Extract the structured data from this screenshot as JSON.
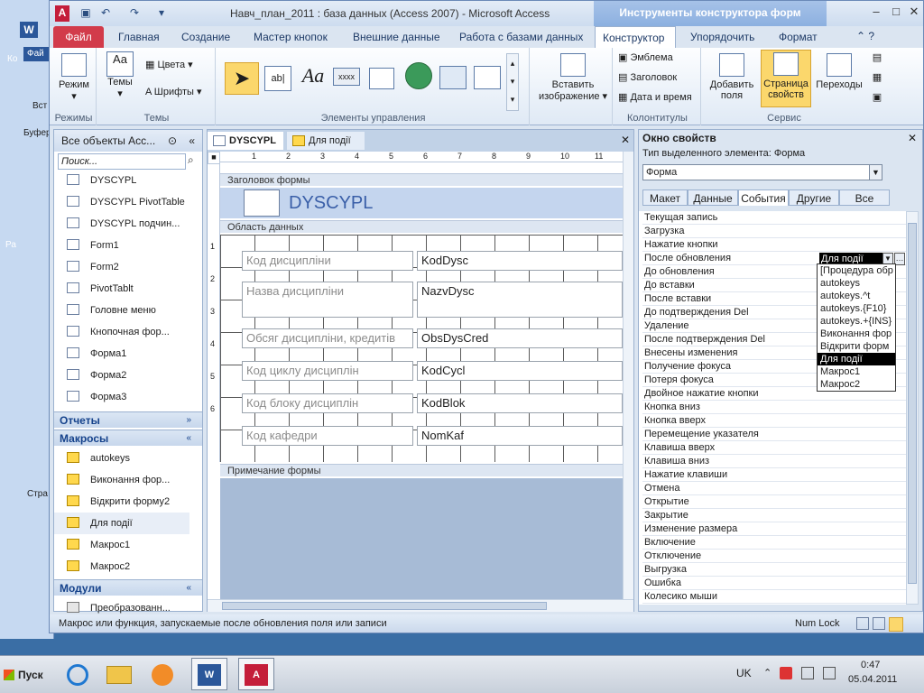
{
  "bg_window": {
    "logo": "W",
    "tab": "Фай",
    "text1": "Вст",
    "text2": "Буфер",
    "text3": "Стра",
    "side1": "Ко",
    "side2": "Ра"
  },
  "window": {
    "title": "Навч_план_2011 : база данных (Access 2007) - Microsoft Access",
    "context_tab": "Инструменты конструктора форм"
  },
  "tabs": {
    "file": "Файл",
    "home": "Главная",
    "create": "Создание",
    "wizard": "Мастер кнопок",
    "external": "Внешние данные",
    "db": "Работа с базами данных",
    "designer": "Конструктор",
    "arrange": "Упорядочить",
    "format": "Формат"
  },
  "ribbon": {
    "modes": {
      "view": "Режим",
      "label": "Режимы"
    },
    "themes": {
      "themes": "Темы",
      "colors": "Цвета",
      "fonts": "Шрифты",
      "label": "Темы"
    },
    "controls": {
      "label": "Элементы управления",
      "textbox": "ab|",
      "label_ctl": "Aa",
      "button": "xxxx"
    },
    "insert": {
      "insert_image": "Вставить",
      "insert_image2": "изображение"
    },
    "header": {
      "logo": "Эмблема",
      "title": "Заголовок",
      "datetime": "Дата и время",
      "label": "Колонтитулы"
    },
    "tools": {
      "add_fields": "Добавить",
      "add_fields2": "поля",
      "props_page": "Страница",
      "props_page2": "свойств",
      "transitions": "Переходы",
      "label": "Сервис"
    }
  },
  "nav": {
    "header": "Все объекты Acc...",
    "search_placeholder": "Поиск...",
    "forms": [
      "DYSCYPL",
      "DYSCYPL PivotTable",
      "DYSCYPL подчин...",
      "Form1",
      "Form2",
      "PivotTablt",
      "Головне меню",
      "Кнопочная фор...",
      "Форма1",
      "Форма2",
      "Форма3"
    ],
    "reports_section": "Отчеты",
    "macros_section": "Макросы",
    "macros": [
      "autokeys",
      "Виконання фор...",
      "Відкрити форму2",
      "Для події",
      "Макрос1",
      "Макрос2"
    ],
    "modules_section": "Модули",
    "modules": [
      "Преобразованн..."
    ]
  },
  "doc": {
    "tab1": "DYSCYPL",
    "tab2": "Для події",
    "header_band": "Заголовок формы",
    "detail_band": "Область данных",
    "footer_band": "Примечание формы",
    "form_title": "DYSCYPL",
    "fields": [
      {
        "label": "Код дисципліни",
        "field": "KodDysc"
      },
      {
        "label": "Назва дисципліни",
        "field": "NazvDysc"
      },
      {
        "label": "Обсяг дисципліни, кредитів",
        "field": "ObsDysCred"
      },
      {
        "label": "Код циклу дисциплін",
        "field": "KodCycl"
      },
      {
        "label": "Код блоку дисциплін",
        "field": "KodBlok"
      },
      {
        "label": "Код кафедри",
        "field": "NomKaf"
      }
    ],
    "ruler_nums": [
      "1",
      "2",
      "3",
      "4",
      "5",
      "6",
      "7",
      "8",
      "9",
      "10",
      "11"
    ],
    "vruler_nums": [
      "1",
      "2",
      "3",
      "4",
      "5",
      "6"
    ]
  },
  "props": {
    "title": "Окно свойств",
    "type_label": "Тип выделенного элемента:  Форма",
    "selector": "Форма",
    "tabs": [
      "Макет",
      "Данные",
      "События",
      "Другие",
      "Все"
    ],
    "rows": [
      "Текущая запись",
      "Загрузка",
      "Нажатие кнопки",
      "После обновления",
      "До обновления",
      "До вставки",
      "После вставки",
      "До подтверждения Del",
      "Удаление",
      "После подтверждения Del",
      "Внесены изменения",
      "Получение фокуса",
      "Потеря фокуса",
      "Двойное нажатие кнопки",
      "Кнопка вниз",
      "Кнопка вверх",
      "Перемещение указателя",
      "Клавиша вверх",
      "Клавиша вниз",
      "Нажатие клавиши",
      "Отмена",
      "Открытие",
      "Закрытие",
      "Изменение размера",
      "Включение",
      "Отключение",
      "Выгрузка",
      "Ошибка",
      "Колесико мыши"
    ],
    "active_value": "Для події",
    "dropdown": [
      "[Процедура обр",
      "autokeys",
      "autokeys.^t",
      "autokeys.{F10}",
      "autokeys.+{INS}",
      "Виконання фор",
      "Відкрити форм",
      "Для події",
      "Макрос1",
      "Макрос2"
    ]
  },
  "status": {
    "text": "Макрос или функция, запускаемые после обновления поля или записи",
    "numlock": "Num Lock"
  },
  "taskbar": {
    "start": "Пуск",
    "lang": "UK",
    "time": "0:47",
    "date": "05.04.2011"
  }
}
